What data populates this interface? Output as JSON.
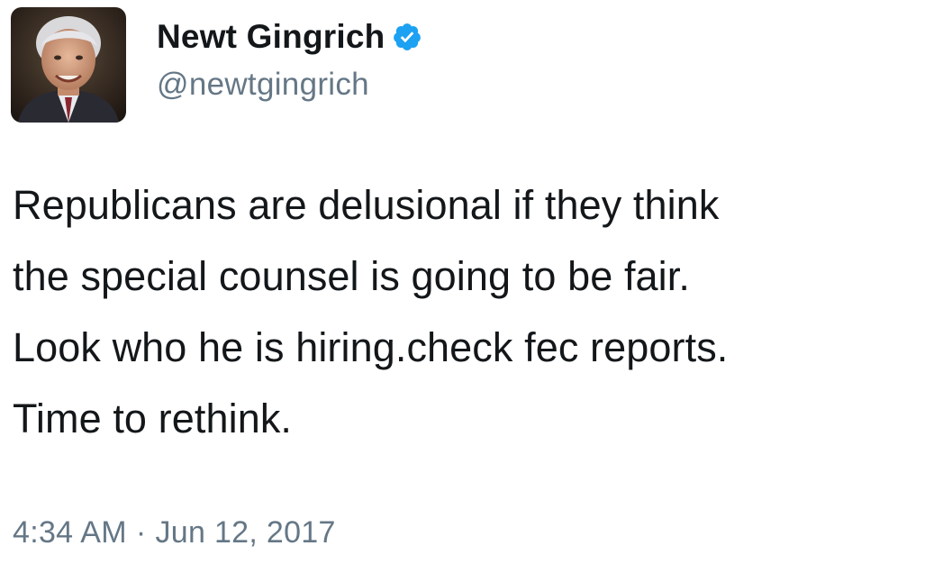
{
  "author": {
    "display_name": "Newt Gingrich",
    "handle": "@newtgingrich",
    "verified": true,
    "avatar_icon": "profile-photo"
  },
  "tweet": {
    "lines": [
      "Republicans are delusional if they think",
      "the special counsel is going to be fair.",
      "Look who he is hiring.check fec reports.",
      "Time to rethink."
    ],
    "time": "4:34 AM",
    "separator": "·",
    "date": "Jun 12, 2017"
  },
  "colors": {
    "text": "#14171a",
    "secondary": "#657786",
    "verified_blue": "#1da1f2",
    "background": "#ffffff"
  }
}
